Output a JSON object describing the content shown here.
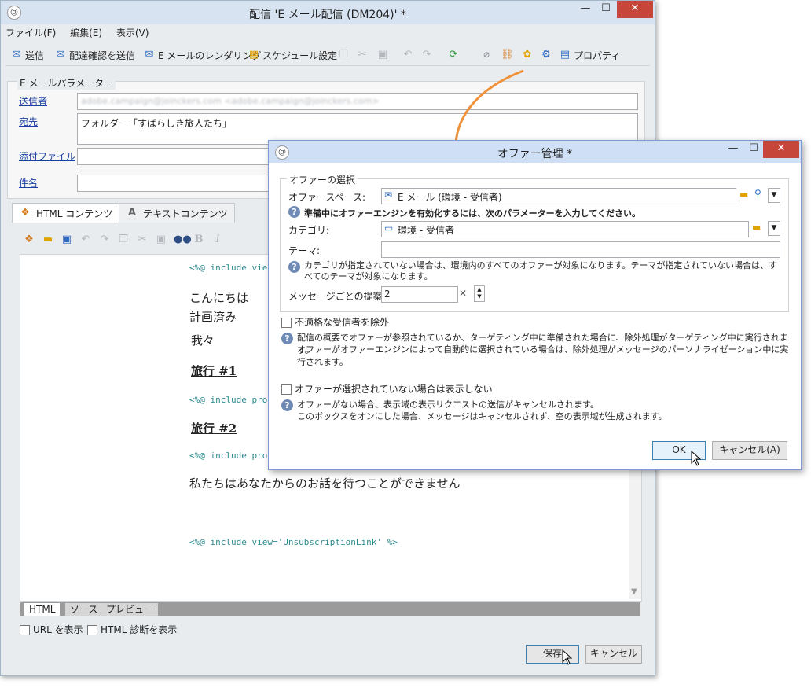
{
  "window": {
    "title": "配信 'E メール配信 (DM204)' *",
    "controls": {
      "minimize": "—",
      "maximize": "☐",
      "close": "✕"
    }
  },
  "menu": {
    "file": "ファイル(F)",
    "edit": "編集(E)",
    "view": "表示(V)"
  },
  "toolbar": {
    "send": "送信",
    "send_proof": "配達確認を送信",
    "render": "E メールのレンダリング",
    "schedule": "スケジュール設定",
    "properties": "プロパティ"
  },
  "params": {
    "group_label": "E メールパラメーター",
    "from_label": "送信者",
    "from_value": "adobe.campaign@joinckers.com <adobe.campaign@joinckers.com>",
    "to_label": "宛先",
    "to_value": "フォルダー「すばらしき旅人たち」",
    "attach_label": "添付ファイル",
    "subject_label": "件名"
  },
  "tabs": {
    "html": "HTML コンテンツ",
    "text": "テキストコンテンツ"
  },
  "editor": {
    "code_view": "<%@ include vie",
    "hello": "こんにちは",
    "planned": "計画済み",
    "we": "我々",
    "trip1": "旅行 #1",
    "code_pro1": "<%@ include pro",
    "trip2": "旅行 #2",
    "code_pro2": "<%@ include pro",
    "wait": "私たちはあなたからのお話を待つことができません",
    "code_unsub": "<%@ include view='UnsubscriptionLink' %>"
  },
  "bottom_tabs": {
    "html": "HTML",
    "source": "ソース",
    "preview": "プレビュー"
  },
  "options": {
    "show_url": "URL を表示",
    "show_diag": "HTML 診断を表示"
  },
  "buttons": {
    "save": "保存",
    "cancel": "キャンセル"
  },
  "dialog": {
    "title": "オファー管理 *",
    "selection_label": "オファーの選択",
    "space_label": "オファースペース:",
    "space_value": "E メール (環境 - 受信者)",
    "engine_note": "準備中にオファーエンジンを有効化するには、次のパラメーターを入力してください。",
    "category_label": "カテゴリ:",
    "category_value": "環境 - 受信者",
    "theme_label": "テーマ:",
    "category_note": "カテゴリが指定されていない場合は、環境内のすべてのオファーが対象になります。テーマが指定されていない場合は、すべてのテーマが対象になります。",
    "count_label": "メッセージごとの提案数:",
    "count_value": "2",
    "exclude_label": "不適格な受信者を除外",
    "exclude_note1": "配信の概要でオファーが参照されているか、ターゲティング中に準備された場合に、除外処理がターゲティング中に実行されます。",
    "exclude_note2": "オファーがオファーエンジンによって自動的に選択されている場合は、除外処理がメッセージのパーソナライゼーション中に実行されます。",
    "hide_label": "オファーが選択されていない場合は表示しない",
    "hide_note1": "オファーがない場合、表示域の表示リクエストの送信がキャンセルされます。",
    "hide_note2": "このボックスをオンにした場合、メッセージはキャンセルされず、空の表示域が生成されます。",
    "ok": "OK",
    "cancel": "キャンセル(A)"
  },
  "colors": {
    "accent": "#1a3fa0",
    "close_red": "#c7463a",
    "annotation_arrow": "#f0923a"
  }
}
